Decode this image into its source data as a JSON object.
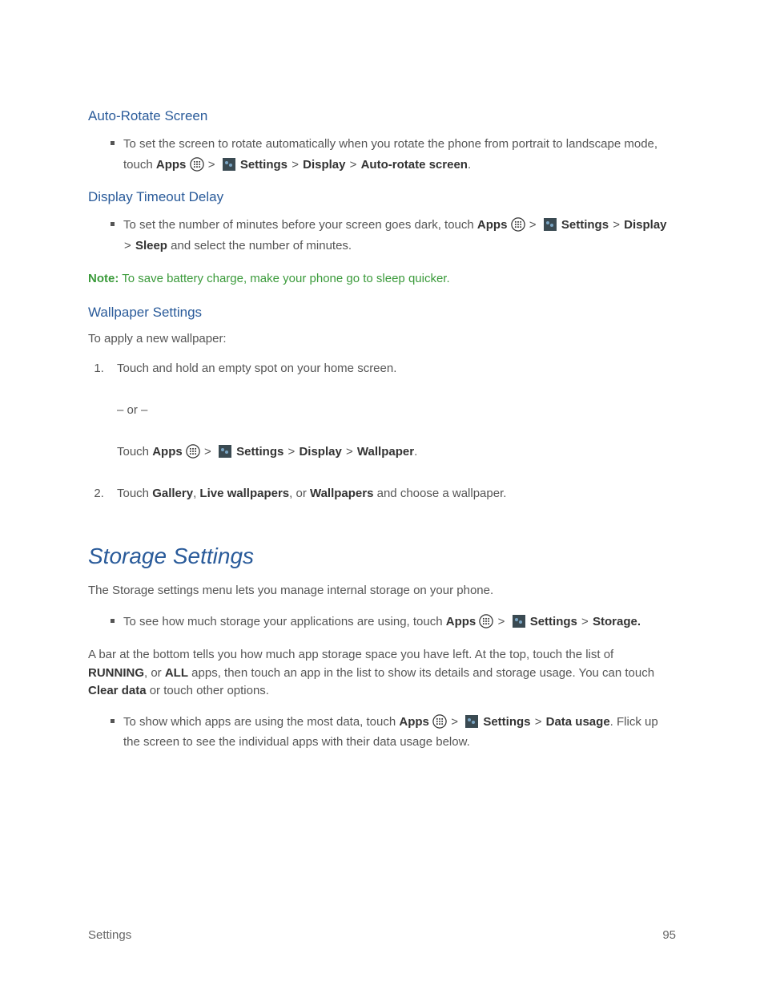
{
  "sections": {
    "autoRotate": {
      "heading": "Auto-Rotate Screen",
      "bullet_pre": "To set the screen to rotate automatically when you rotate the phone from portrait to landscape mode, touch ",
      "apps": "Apps",
      "settings": "Settings",
      "display": "Display",
      "autorotate": "Auto-rotate screen"
    },
    "timeout": {
      "heading": "Display Timeout Delay",
      "bullet_pre": "To set the number of minutes before your screen goes dark, touch ",
      "apps": "Apps",
      "settings": "Settings",
      "display": "Display",
      "sleep": "Sleep",
      "bullet_post": " and select the number of minutes.",
      "note_label": "Note:",
      "note_text": " To save battery charge, make your phone go to sleep quicker."
    },
    "wallpaper": {
      "heading": "Wallpaper Settings",
      "intro": "To apply a new wallpaper:",
      "step1": "Touch and hold an empty spot on your home screen.",
      "or": "– or –",
      "step1b_pre": "Touch ",
      "apps": "Apps",
      "settings": "Settings",
      "display": "Display",
      "wallpaper": "Wallpaper",
      "step2_pre": "Touch ",
      "gallery": "Gallery",
      "live": "Live wallpapers",
      "wallpapers": "Wallpapers",
      "step2_post": " and choose a wallpaper."
    },
    "storage": {
      "heading": "Storage Settings",
      "intro": "The Storage settings menu lets you manage internal storage on your phone.",
      "b1_pre": "To see how much storage your applications are using, touch ",
      "apps": "Apps",
      "settings": "Settings",
      "storage_label": "Storage.",
      "para2_pre": "A bar at the bottom tells you how much app storage space you have left. At the top, touch the list of ",
      "running": "RUNNING",
      "or": ", or ",
      "all": "ALL",
      "para2_mid": " apps, then touch an app in the list to show its details and storage usage. You can touch ",
      "clear": "Clear data",
      "para2_post": " or touch other options.",
      "b2_pre": "To show which apps are using the most data, touch ",
      "datausage": "Data usage",
      "b2_post": ". Flick up the screen to see the individual apps with their data usage below."
    }
  },
  "footer": {
    "left": "Settings",
    "right": "95"
  },
  "symbols": {
    "gt": ">"
  }
}
